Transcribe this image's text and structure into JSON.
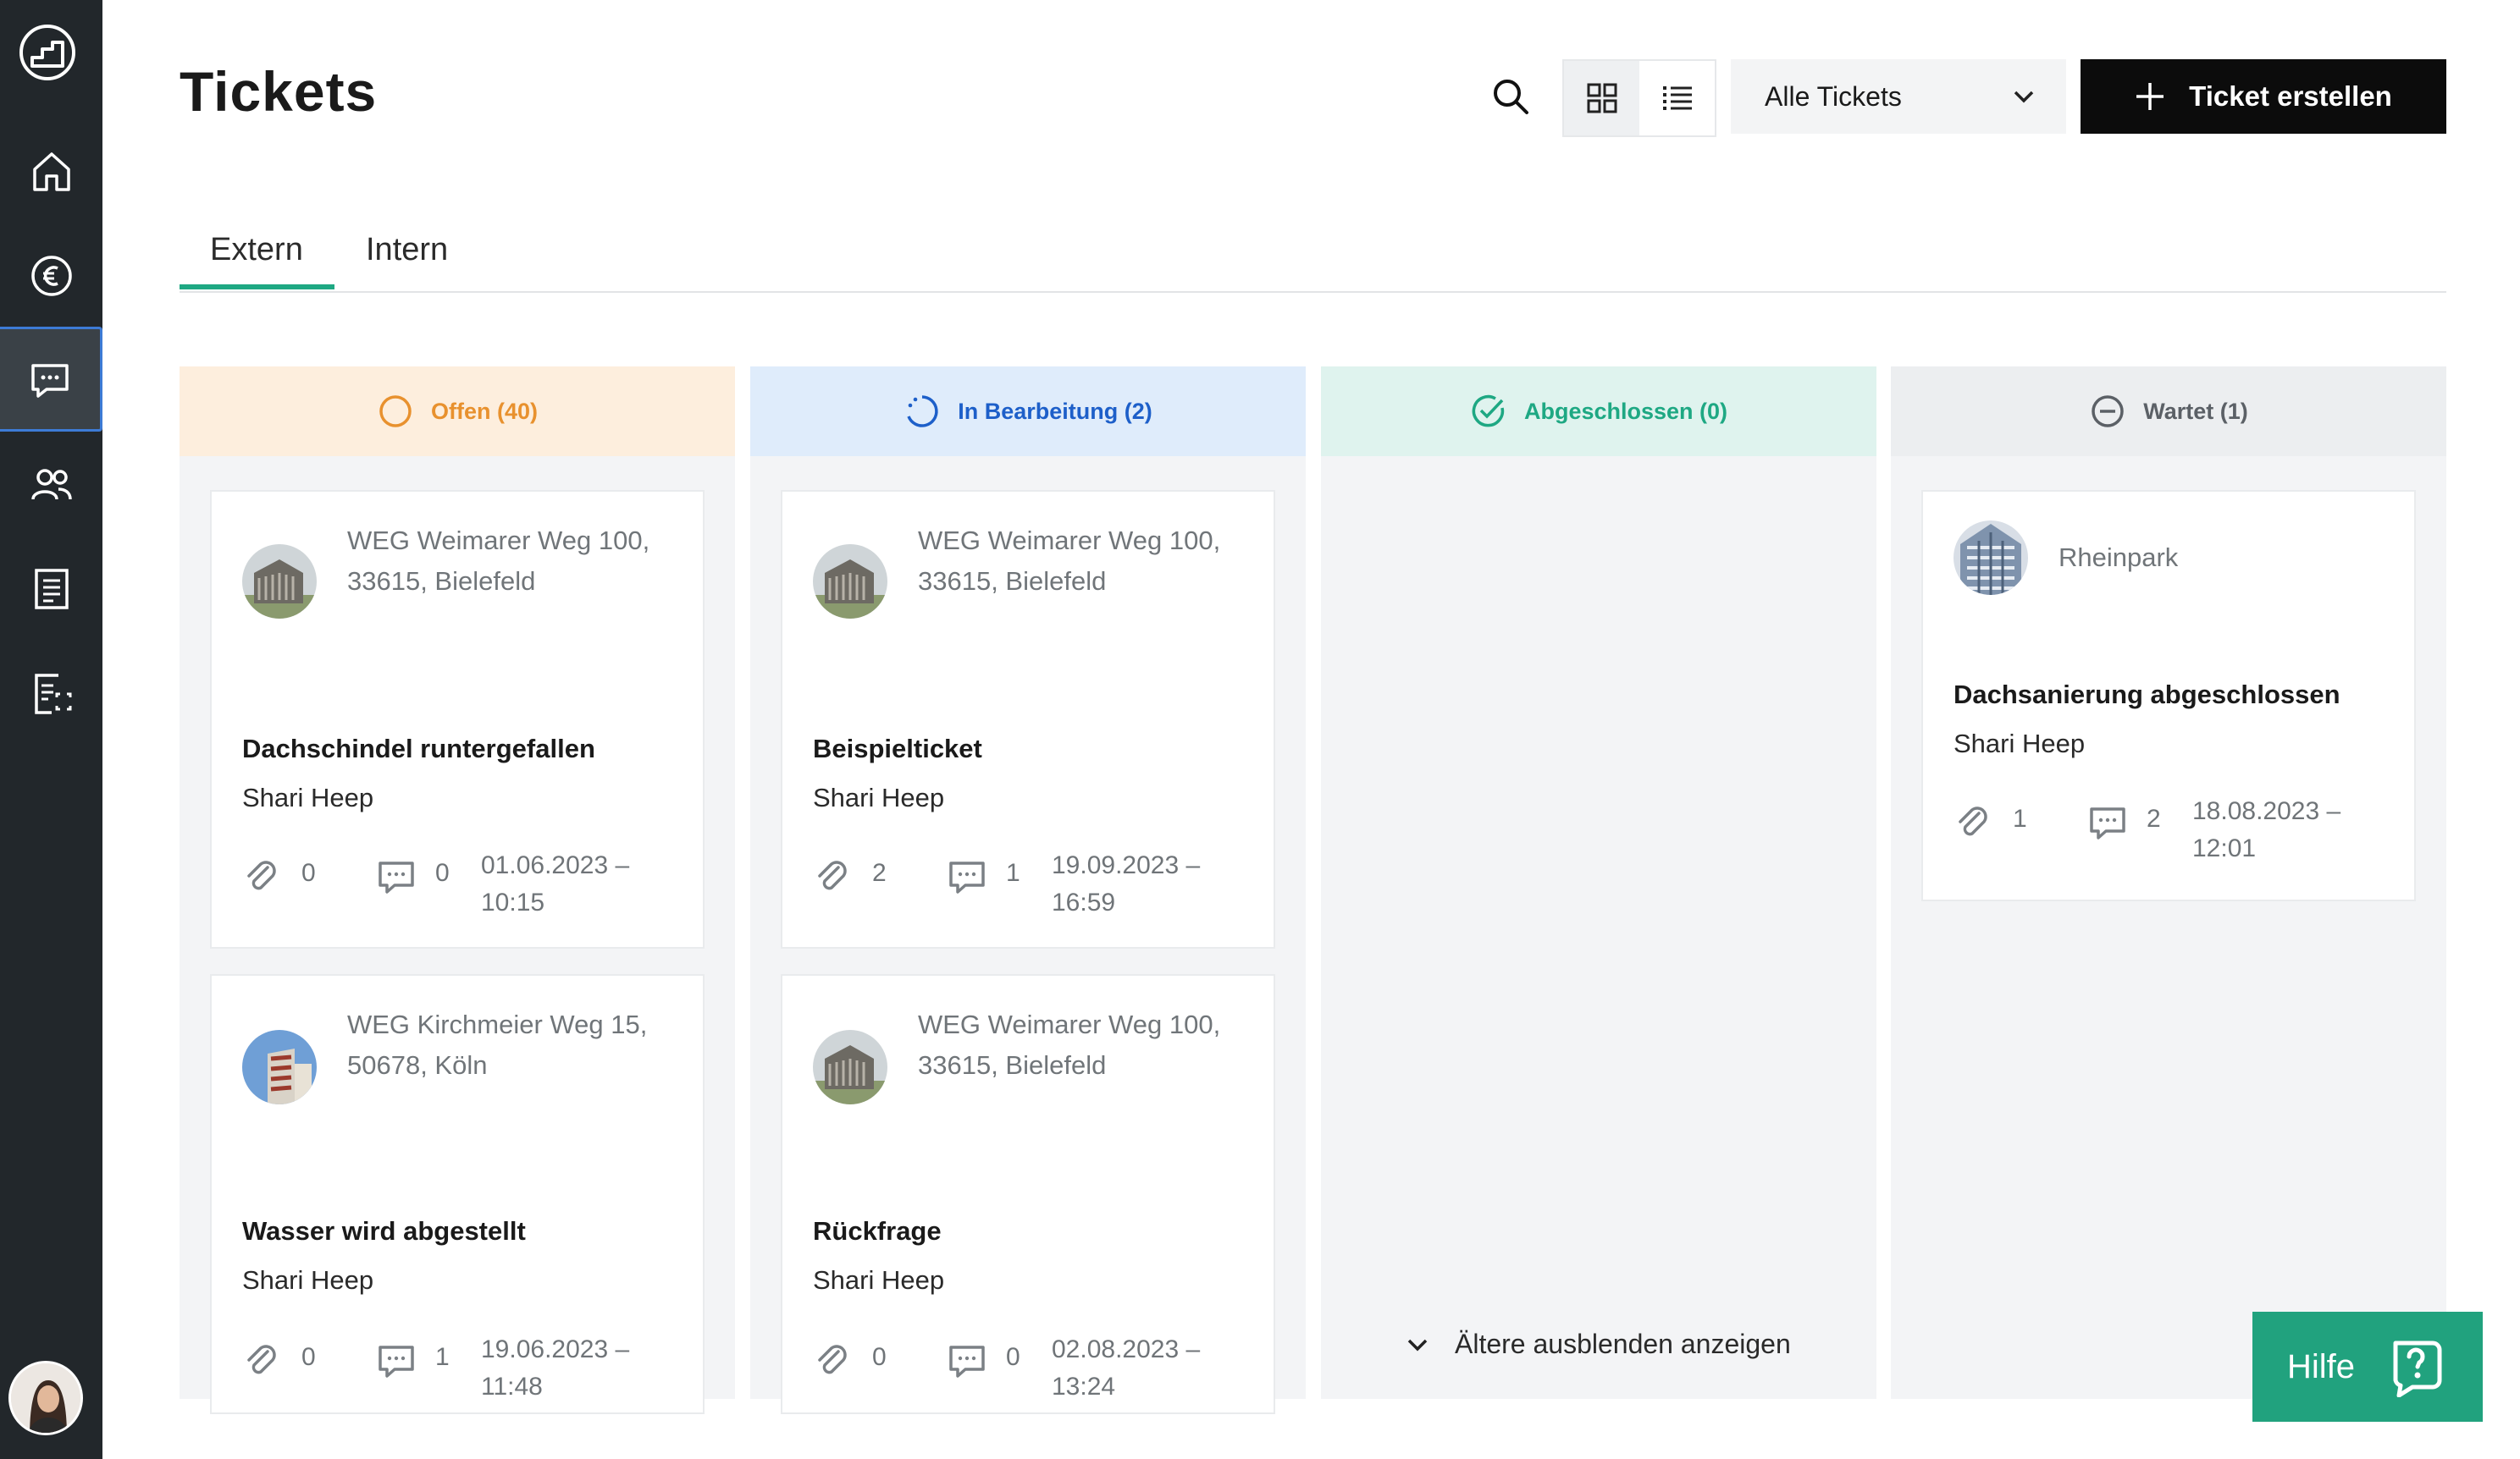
{
  "header": {
    "title": "Tickets",
    "filter_value": "Alle Tickets",
    "create_label": "Ticket erstellen"
  },
  "tabs": [
    {
      "label": "Extern"
    },
    {
      "label": "Intern"
    }
  ],
  "columns": [
    {
      "label": "Offen (40)",
      "color": "#e8912e",
      "bg": "#fdeedd"
    },
    {
      "label": "In Bearbeitung (2)",
      "color": "#1d5fc9",
      "bg": "#dfecfb"
    },
    {
      "label": "Abgeschlossen (0)",
      "color": "#1ea883",
      "bg": "#dff3ee"
    },
    {
      "label": "Wartet (1)",
      "color": "#5b6066",
      "bg": "#eceef0"
    }
  ],
  "cards": {
    "c1": {
      "address": "WEG Weimarer Weg 100, 33615, Bielefeld",
      "title": "Dachschindel runtergefallen",
      "owner": "Shari Heep",
      "attachments": "0",
      "comments": "0",
      "date1": "01.06.2023 –",
      "date2": "10:15"
    },
    "c2": {
      "address": "WEG Kirchmeier Weg 15, 50678, Köln",
      "title": "Wasser wird abgestellt",
      "owner": "Shari Heep",
      "attachments": "0",
      "comments": "1",
      "date1": "19.06.2023 –",
      "date2": "11:48"
    },
    "c3": {
      "address": "WEG Weimarer Weg 100, 33615, Bielefeld",
      "title": "Beispielticket",
      "owner": "Shari Heep",
      "attachments": "2",
      "comments": "1",
      "date1": "19.09.2023 –",
      "date2": "16:59"
    },
    "c4": {
      "address": "WEG Weimarer Weg 100, 33615, Bielefeld",
      "title": "Rückfrage",
      "owner": "Shari Heep",
      "attachments": "0",
      "comments": "0",
      "date1": "02.08.2023 –",
      "date2": "13:24"
    },
    "c5": {
      "address": "Rheinpark",
      "title": "Dachsanierung abgeschlossen",
      "owner": "Shari Heep",
      "attachments": "1",
      "comments": "2",
      "date1": "18.08.2023 –",
      "date2": "12:01"
    }
  },
  "older_label": "Ältere ausblenden anzeigen",
  "help_label": "Hilfe"
}
